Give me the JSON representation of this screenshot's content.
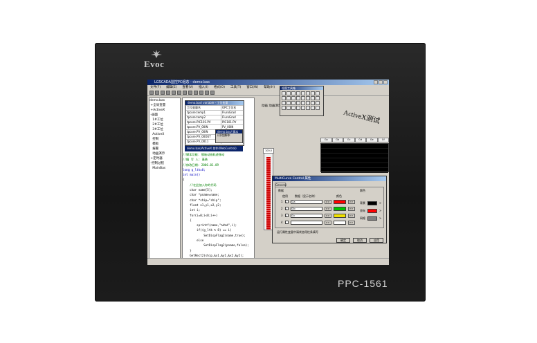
{
  "device": {
    "brand": "Evoc",
    "model": "PPC-1561"
  },
  "window": {
    "title": "LGSCADA监控PC组态 - demo.bas"
  },
  "menu": [
    "文件(F)",
    "编辑(E)",
    "查看(V)",
    "插入(I)",
    "格式(O)",
    "工具(T)",
    "窗口(W)",
    "帮助(H)"
  ],
  "tree": {
    "items": [
      "demo.bas",
      "全局变量",
      "ActiveX",
      "画面",
      "1#工位",
      "2#工位",
      "3#工位",
      "ActiveX",
      "控制",
      "模板",
      "报警",
      "动画演示",
      "定时器",
      "控制过程",
      "MainBas"
    ]
  },
  "var_dialog": {
    "title": "demo.bas/ variable - 工位变量",
    "header": [
      "工位变量名",
      "OPC工位名"
    ],
    "rows": [
      [
        "tpcore.temp1",
        "FluroGrad"
      ],
      [
        "tpcore.temp2",
        "FluroGrad"
      ],
      [
        "tpcore.PIC101.PV",
        "PIC101.PV"
      ],
      [
        "tpcore.PV_00IN",
        "PV_00IN"
      ],
      [
        "tpcore.PV_00IN",
        "PV_00IN"
      ],
      [
        "tpcore.PV_00OUT",
        "PV_00OUT"
      ],
      [
        "tpcore.PV_0011",
        "PV_0011"
      ]
    ]
  },
  "popup": {
    "title": "demo.bas/ 脚本",
    "line1": "//添加脚本"
  },
  "activex_bar": {
    "label": "demo.bas/ActiveX 控件(WebControl)"
  },
  "code": {
    "lines": [
      "//脚本功能: 钢板动画轨迹移动",
      "//编 写 人: 基勇",
      "//修改日期: 2006.01.09",
      "long g_ltk=0;",
      "int main()",
      "{",
      "    //在此加入你的代码",
      "    char name[5];",
      "    char *pname=name;",
      "    char *ship=\"ship\";",
      "    float x1,y1,x2,y2;",
      "    int i;",
      "    for(i=0;i<8;i++)",
      "    {",
      "        sprintf(name,\"%d%d\",i);",
      "        if((g_ltk % 8) == i)",
      "            SetDispFlag2(name,true);",
      "        else",
      "            SetDispFlag2(pname,false);",
      "    }",
      "    GetRect2(ship,&x1,&y1,&x2,&y2);",
      "    if(x2 < 0)"
    ]
  },
  "canvas": {
    "labels": "动画  动画演示",
    "thermo_value": "100.0",
    "thermo_level": 0.95,
    "active_text": "ActiveX测试",
    "table_headers": [
      "Ga",
      "Gb",
      "Gc",
      "Gd",
      "Ge",
      "Gf"
    ]
  },
  "palette": {
    "title": "绘图工具箱"
  },
  "curve_dialog": {
    "title": "MultiCurve Control 属性",
    "tab": "General",
    "group_data": "数据",
    "group_color": "颜色",
    "col_use": "使用",
    "col_data": "数据（显示名称）",
    "col_color": "颜色",
    "rows": [
      {
        "n": "1",
        "checked": true,
        "value": "Ga",
        "color": "#ff0000"
      },
      {
        "n": "2",
        "checked": true,
        "value": "Gb",
        "color": "#00c000"
      },
      {
        "n": "3",
        "checked": true,
        "value": "Gc",
        "color": "#f0e000"
      },
      {
        "n": "4",
        "checked": false,
        "value": "",
        "color": "#ffffff"
      }
    ],
    "color_items": [
      {
        "label": "背景",
        "color": "#000000"
      },
      {
        "label": "坐标",
        "color": "#ff0000"
      },
      {
        "label": "网格",
        "color": "#808080"
      }
    ],
    "note": "运行属性变量中请状态用柱条填写",
    "ok": "确定",
    "cancel": "取消",
    "apply": "应用"
  }
}
